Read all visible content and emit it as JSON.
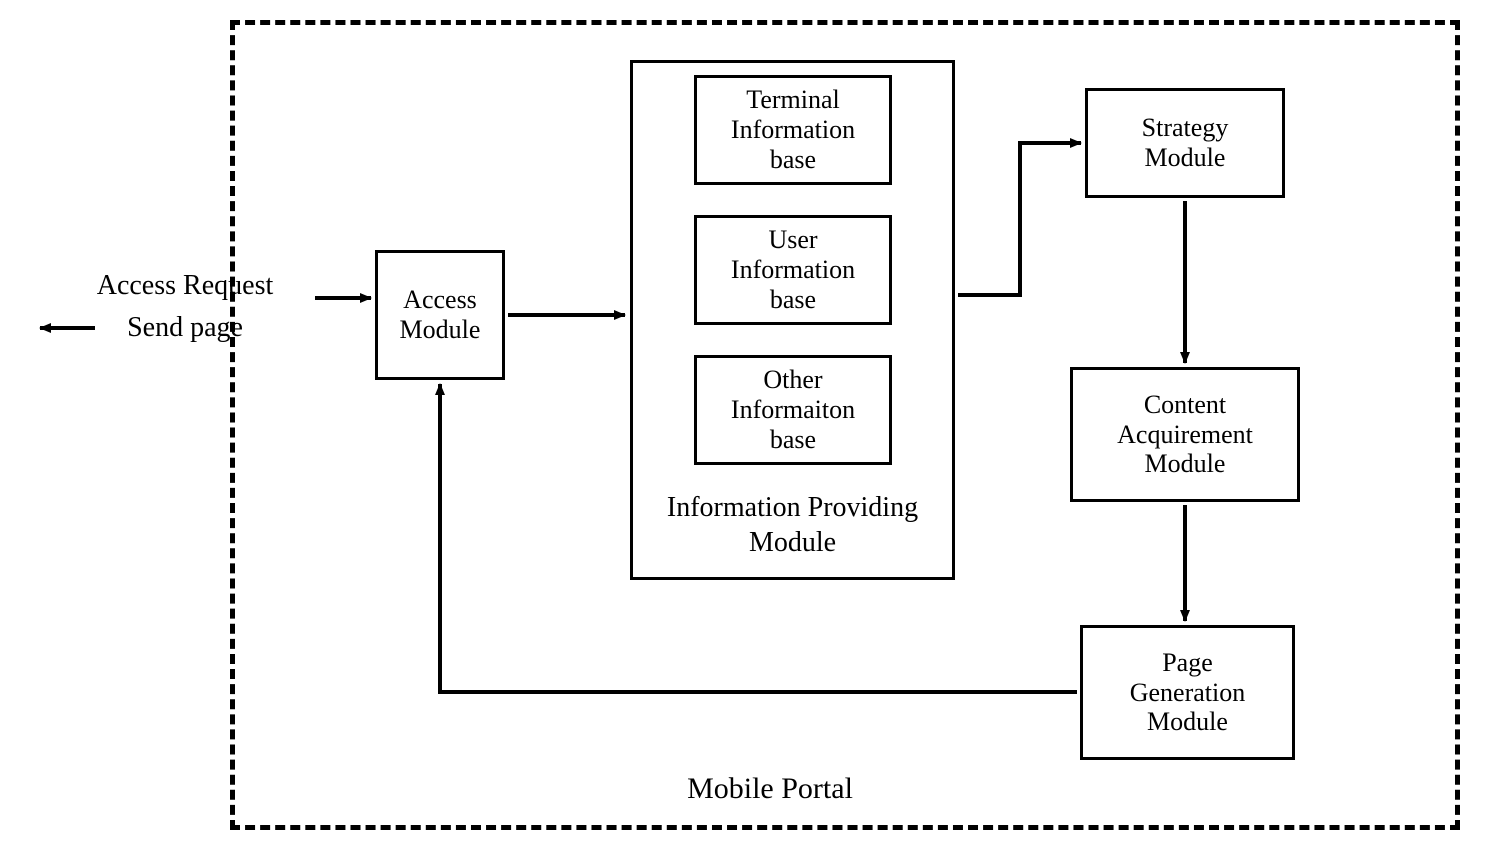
{
  "external": {
    "access_request": "Access Request",
    "send_page": "Send page"
  },
  "portal": {
    "title": "Mobile Portal",
    "access_module": "Access\nModule",
    "info_module": {
      "title": "Information Providing\nModule",
      "terminal_base": "Terminal\nInformation\nbase",
      "user_base": "User\nInformation\nbase",
      "other_base": "Other\nInformaiton\nbase"
    },
    "strategy_module": "Strategy\nModule",
    "content_module": "Content\nAcquirement\nModule",
    "page_module": "Page\nGeneration\nModule"
  }
}
